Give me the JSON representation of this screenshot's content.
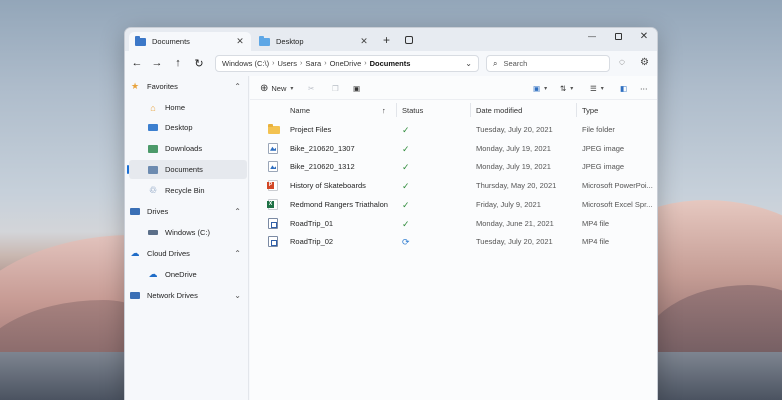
{
  "tabs": [
    {
      "label": "Documents",
      "icon": "documents-folder-icon",
      "active": true
    },
    {
      "label": "Desktop",
      "icon": "desktop-folder-icon",
      "active": false
    }
  ],
  "tab_close_glyph": "✕",
  "new_tab_glyph": "+",
  "window_controls": {
    "minimize": "—",
    "close": "✕"
  },
  "nav": {
    "back": "←",
    "forward": "→",
    "up": "↑",
    "refresh": "↻"
  },
  "breadcrumb": [
    "Windows (C:\\)",
    "Users",
    "Sara",
    "OneDrive",
    "Documents"
  ],
  "breadcrumb_sep": "›",
  "search": {
    "placeholder": "Search"
  },
  "sidebar": {
    "favorites": {
      "label": "Favorites",
      "items": [
        {
          "label": "Home",
          "icon": "home-icon"
        },
        {
          "label": "Desktop",
          "icon": "desktop-icon"
        },
        {
          "label": "Downloads",
          "icon": "downloads-icon"
        },
        {
          "label": "Documents",
          "icon": "documents-icon",
          "selected": true
        },
        {
          "label": "Recycle Bin",
          "icon": "recycle-bin-icon"
        }
      ]
    },
    "drives": {
      "label": "Drives",
      "items": [
        {
          "label": "Windows (C:)",
          "icon": "drive-icon"
        }
      ]
    },
    "cloud": {
      "label": "Cloud Drives",
      "items": [
        {
          "label": "OneDrive",
          "icon": "onedrive-icon"
        }
      ]
    },
    "network": {
      "label": "Network Drives"
    }
  },
  "toolbar": {
    "new_label": "New"
  },
  "columns": {
    "name": "Name",
    "status": "Status",
    "date": "Date modified",
    "type": "Type"
  },
  "files": [
    {
      "name": "Project Files",
      "kind": "folder",
      "status": "synced",
      "date": "Tuesday, July 20, 2021",
      "type": "File folder"
    },
    {
      "name": "Bike_210620_1307",
      "kind": "image",
      "status": "synced",
      "date": "Monday, July 19, 2021",
      "type": "JPEG image"
    },
    {
      "name": "Bike_210620_1312",
      "kind": "image",
      "status": "synced",
      "date": "Monday, July 19, 2021",
      "type": "JPEG image"
    },
    {
      "name": "History of Skateboards",
      "kind": "ppt",
      "status": "synced",
      "date": "Thursday, May 20, 2021",
      "type": "Microsoft PowerPoi..."
    },
    {
      "name": "Redmond Rangers Triathalon",
      "kind": "xls",
      "status": "synced",
      "date": "Friday, July 9, 2021",
      "type": "Microsoft Excel Spr..."
    },
    {
      "name": "RoadTrip_01",
      "kind": "video",
      "status": "synced",
      "date": "Monday, June 21, 2021",
      "type": "MP4 file"
    },
    {
      "name": "RoadTrip_02",
      "kind": "video",
      "status": "syncing",
      "date": "Tuesday, July 20, 2021",
      "type": "MP4 file"
    }
  ],
  "status_glyphs": {
    "synced": "✓",
    "syncing": "⟳"
  },
  "colors": {
    "accent": "#1a6fd4",
    "synced": "#2e8b3a",
    "syncing": "#2f7dd1"
  }
}
